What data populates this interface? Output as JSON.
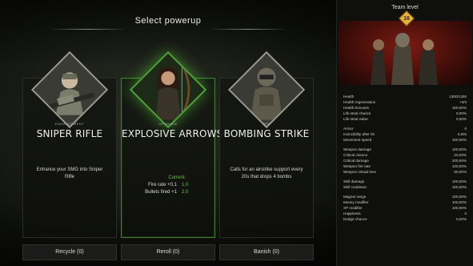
{
  "title": "Select powerup",
  "cards": [
    {
      "type": "Enhancement",
      "name": "SNIPER RIFLE",
      "description": "Enhance your SMG into Sniper Rifle",
      "selected": false,
      "icon": "soldier-with-rifle-icon"
    },
    {
      "type": "Upgrade",
      "name": "EXPLOSIVE ARROWS",
      "selected": true,
      "icon": "archer-icon",
      "current_label": "Current:",
      "stats": [
        {
          "label": "Fire rate +0,1",
          "value": "1,0"
        },
        {
          "label": "Bullets fired +1",
          "value": "2,0"
        }
      ]
    },
    {
      "type": "New",
      "name": "BOMBING STRIKE",
      "description": "Calls for an airstrike support every 20s that drops 4 bombs",
      "selected": false,
      "icon": "bomber-soldier-icon"
    }
  ],
  "actions": {
    "recycle": "Recycle (0)",
    "reroll": "Reroll (0)",
    "banish": "Banish (0)"
  },
  "team": {
    "header": "Team level",
    "level": "16",
    "stat_groups": [
      [
        {
          "label": "Health",
          "value": "1300/1300"
        },
        {
          "label": "Health regeneration",
          "value": "+0/s"
        },
        {
          "label": "Health bonuses",
          "value": "100,00%"
        },
        {
          "label": "Life steal chance",
          "value": "0,00%"
        },
        {
          "label": "Life steal value",
          "value": "0,00%"
        }
      ],
      [
        {
          "label": "Armor",
          "value": "0"
        },
        {
          "label": "Invincibility after hit",
          "value": "0,00s"
        },
        {
          "label": "Movement speed",
          "value": "100,00%"
        }
      ],
      [
        {
          "label": "Weapon damage",
          "value": "100,00%"
        },
        {
          "label": "Critical chance",
          "value": "20,00%"
        },
        {
          "label": "Critical damage",
          "value": "200,00%"
        },
        {
          "label": "Weapon fire rate",
          "value": "100,00%"
        },
        {
          "label": "Weapon reload time",
          "value": "90,00%"
        }
      ],
      [
        {
          "label": "Skill damage",
          "value": "100,00%"
        },
        {
          "label": "Skill cooldown",
          "value": "100,00%"
        }
      ],
      [
        {
          "label": "Magnet range",
          "value": "100,00%"
        },
        {
          "label": "Money modifier",
          "value": "100,00%"
        },
        {
          "label": "XP modifier",
          "value": "100,00%"
        },
        {
          "label": "Happiness",
          "value": "0"
        },
        {
          "label": "Dodge chance",
          "value": "0,00%"
        }
      ]
    ]
  },
  "colors": {
    "accent_green": "#6fc04c",
    "level_badge": "#e6b340",
    "team_bg": "#7a1c12"
  }
}
